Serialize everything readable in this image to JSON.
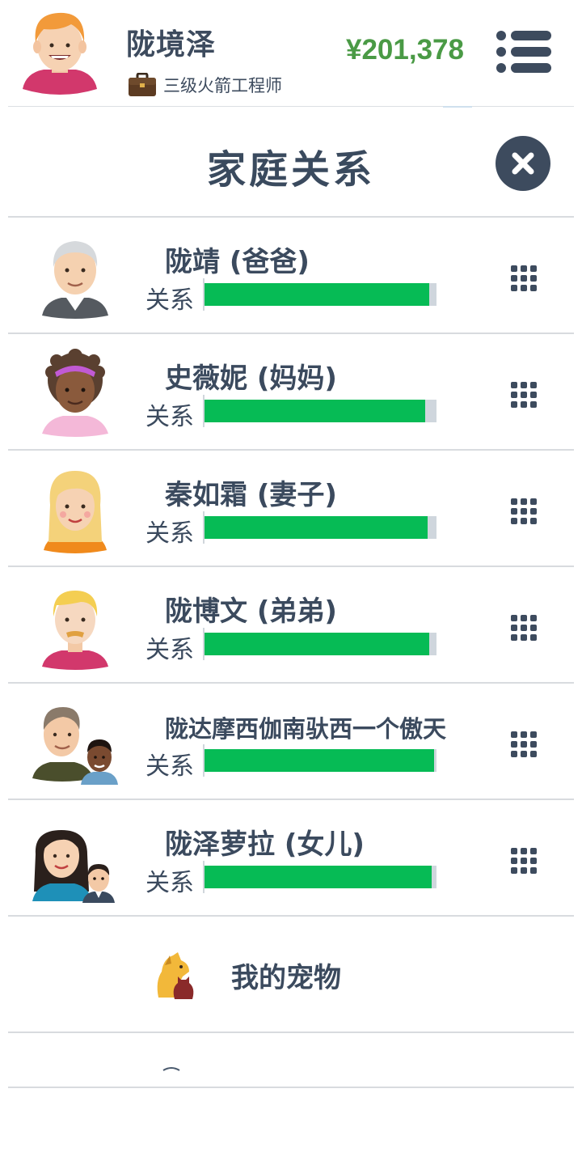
{
  "header": {
    "name": "陇境泽",
    "job": "三级火箭工程师",
    "money": "¥201,378"
  },
  "modal": {
    "title": "家庭关系"
  },
  "relation_label": "关系",
  "family": [
    {
      "name": "陇靖 (爸爸)",
      "relationship": 0.97,
      "avatar": "old-man-avatar-icon"
    },
    {
      "name": "史薇妮 (妈妈)",
      "relationship": 0.95,
      "avatar": "old-woman-avatar-icon"
    },
    {
      "name": "秦如霜 (妻子)",
      "relationship": 0.96,
      "avatar": "blonde-woman-avatar-icon"
    },
    {
      "name": "陇博文 (弟弟)",
      "relationship": 0.97,
      "avatar": "blond-man-avatar-icon"
    },
    {
      "name": "陇达摩西伽南驮西一个傲天",
      "relationship": 0.99,
      "avatar": "man-with-child-avatar-icon"
    },
    {
      "name": "陇泽萝拉 (女儿)",
      "relationship": 0.98,
      "avatar": "woman-with-child-avatar-icon"
    }
  ],
  "pets": {
    "label": "我的宠物",
    "icon": "dog-cat-icon"
  },
  "colors": {
    "text": "#3b4a5e",
    "money": "#4a9a45",
    "bar_fill": "#06bb55",
    "bar_bg": "#cfd6dd"
  }
}
